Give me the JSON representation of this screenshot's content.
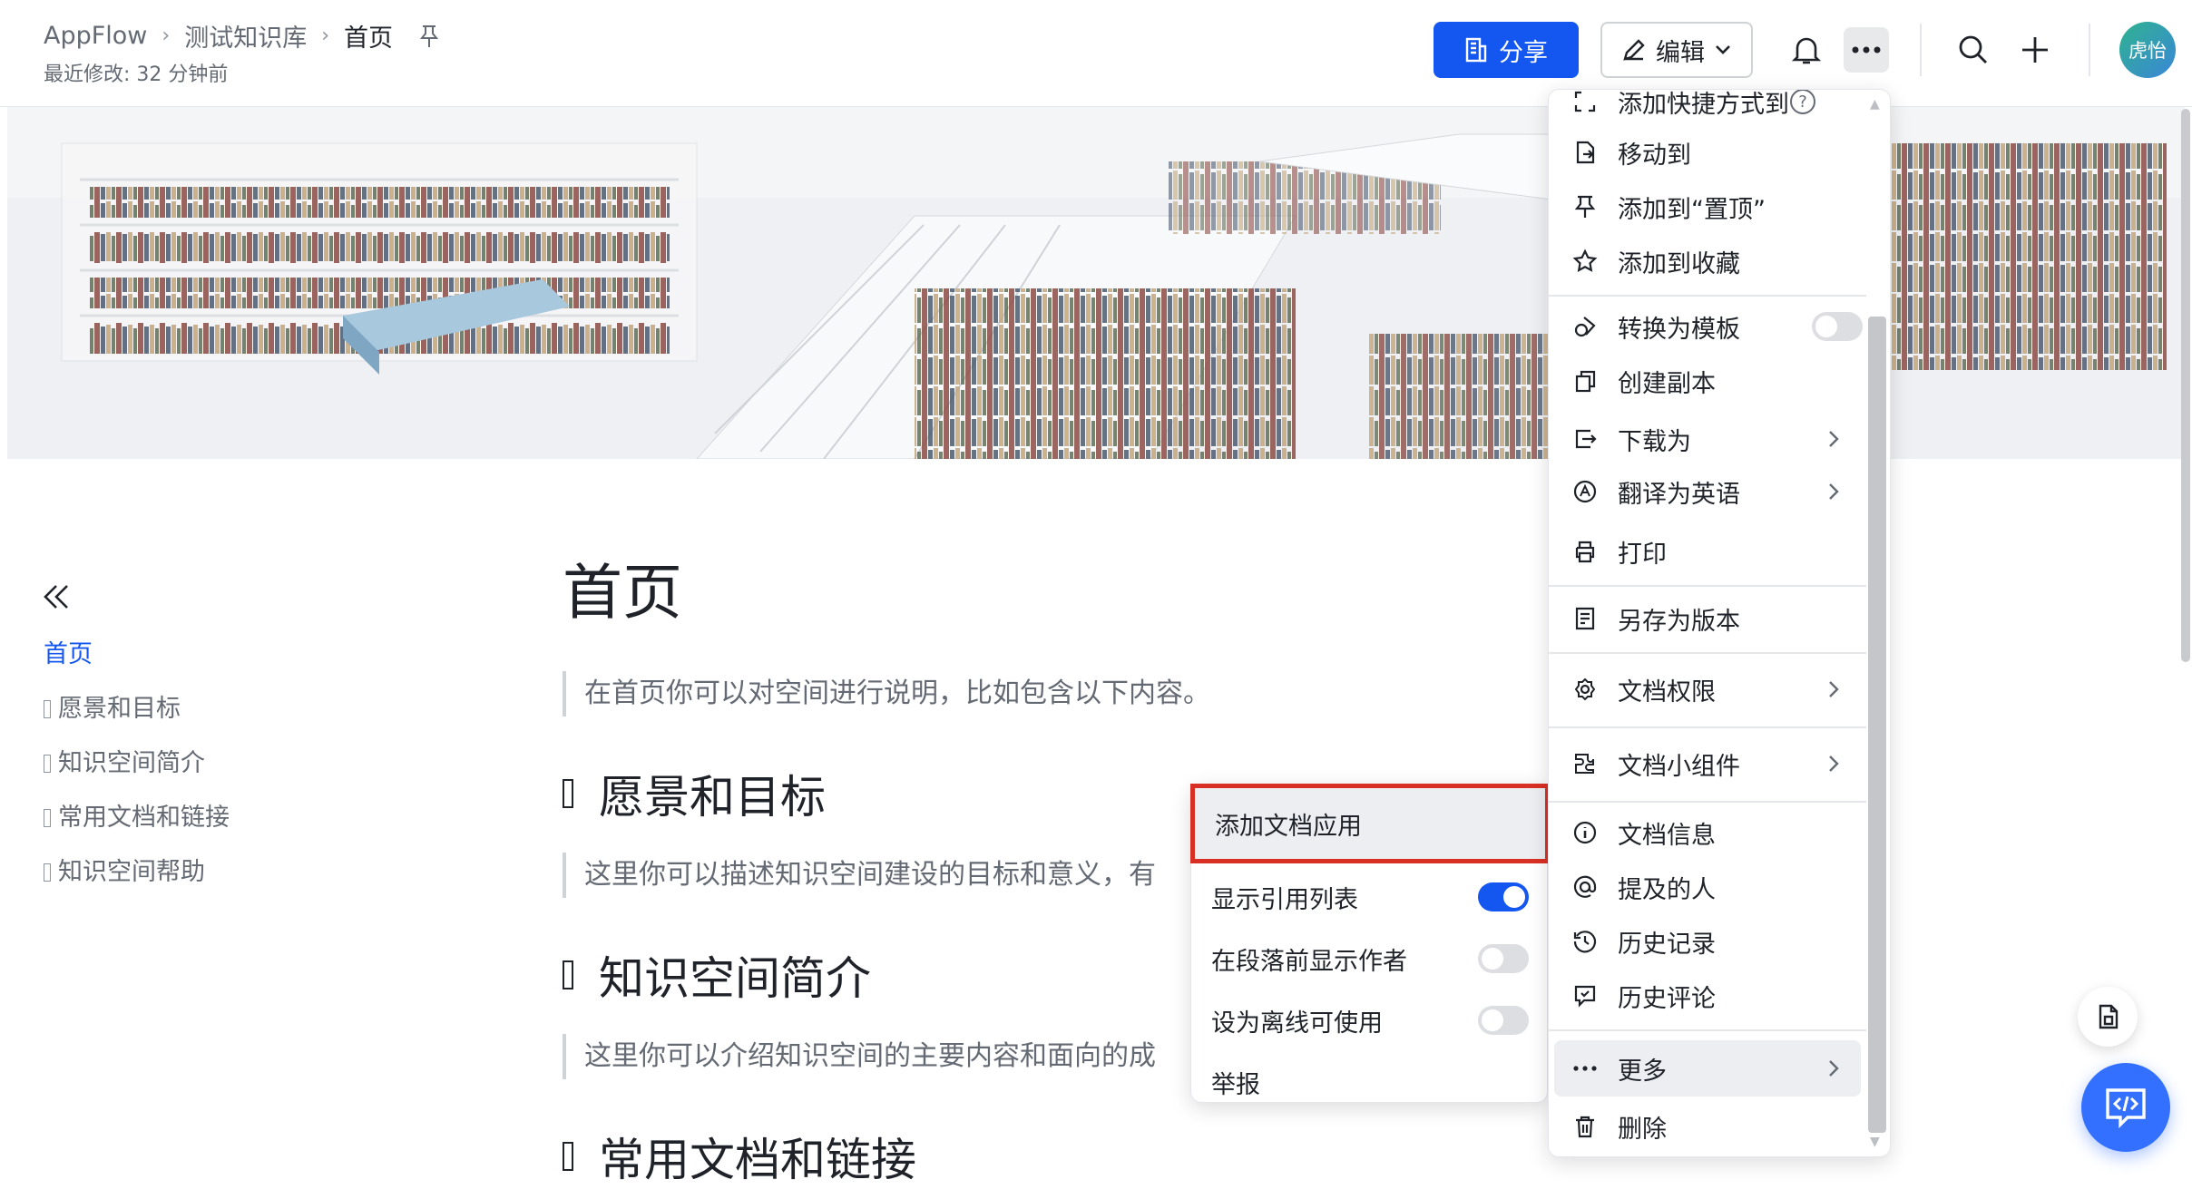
{
  "header": {
    "breadcrumb": [
      "AppFlow",
      "测试知识库",
      "首页"
    ],
    "last_modified": "最近修改: 32 分钟前",
    "share_label": "分享",
    "edit_label": "编辑",
    "avatar_text": "虎怡"
  },
  "toc": {
    "items": [
      "首页",
      "愿景和目标",
      "知识空间简介",
      "常用文档和链接",
      "知识空间帮助"
    ]
  },
  "doc": {
    "title": "首页",
    "intro": "在首页你可以对空间进行说明，比如包含以下内容。",
    "sections": [
      {
        "heading": "愿景和目标",
        "text": "这里你可以描述知识空间建设的目标和意义，有"
      },
      {
        "heading": "知识空间简介",
        "text": "这里你可以介绍知识空间的主要内容和面向的成"
      },
      {
        "heading": "常用文档和链接"
      }
    ]
  },
  "submenu": {
    "items": [
      {
        "label": "添加文档应用"
      },
      {
        "label": "显示引用列表",
        "toggle": true
      },
      {
        "label": "在段落前显示作者",
        "toggle": false
      },
      {
        "label": "设为离线可使用",
        "toggle": false
      },
      {
        "label": "举报"
      }
    ]
  },
  "menu": {
    "items": [
      {
        "label": "添加快捷方式到",
        "icon": "shortcut-icon"
      },
      {
        "label": "移动到",
        "icon": "move-icon"
      },
      {
        "label": "添加到“置顶”",
        "icon": "pin-icon"
      },
      {
        "label": "添加到收藏",
        "icon": "star-icon"
      },
      {
        "label": "转换为模板",
        "icon": "template-icon",
        "toggle": false
      },
      {
        "label": "创建副本",
        "icon": "copy-icon"
      },
      {
        "label": "下载为",
        "icon": "download-icon"
      },
      {
        "label": "翻译为英语",
        "icon": "translate-icon"
      },
      {
        "label": "打印",
        "icon": "print-icon"
      },
      {
        "label": "另存为版本",
        "icon": "version-icon"
      },
      {
        "label": "文档权限",
        "icon": "gear-icon"
      },
      {
        "label": "文档小组件",
        "icon": "widget-icon"
      },
      {
        "label": "文档信息",
        "icon": "info-icon"
      },
      {
        "label": "提及的人",
        "icon": "at-icon"
      },
      {
        "label": "历史记录",
        "icon": "history-icon"
      },
      {
        "label": "历史评论",
        "icon": "comment-icon"
      },
      {
        "label": "更多",
        "icon": "more-icon"
      },
      {
        "label": "删除",
        "icon": "trash-icon"
      }
    ],
    "help_mark": "?"
  },
  "colors": {
    "accent": "#1456f0",
    "highlight_border": "#d93025",
    "ai_button": "#3370ff"
  }
}
